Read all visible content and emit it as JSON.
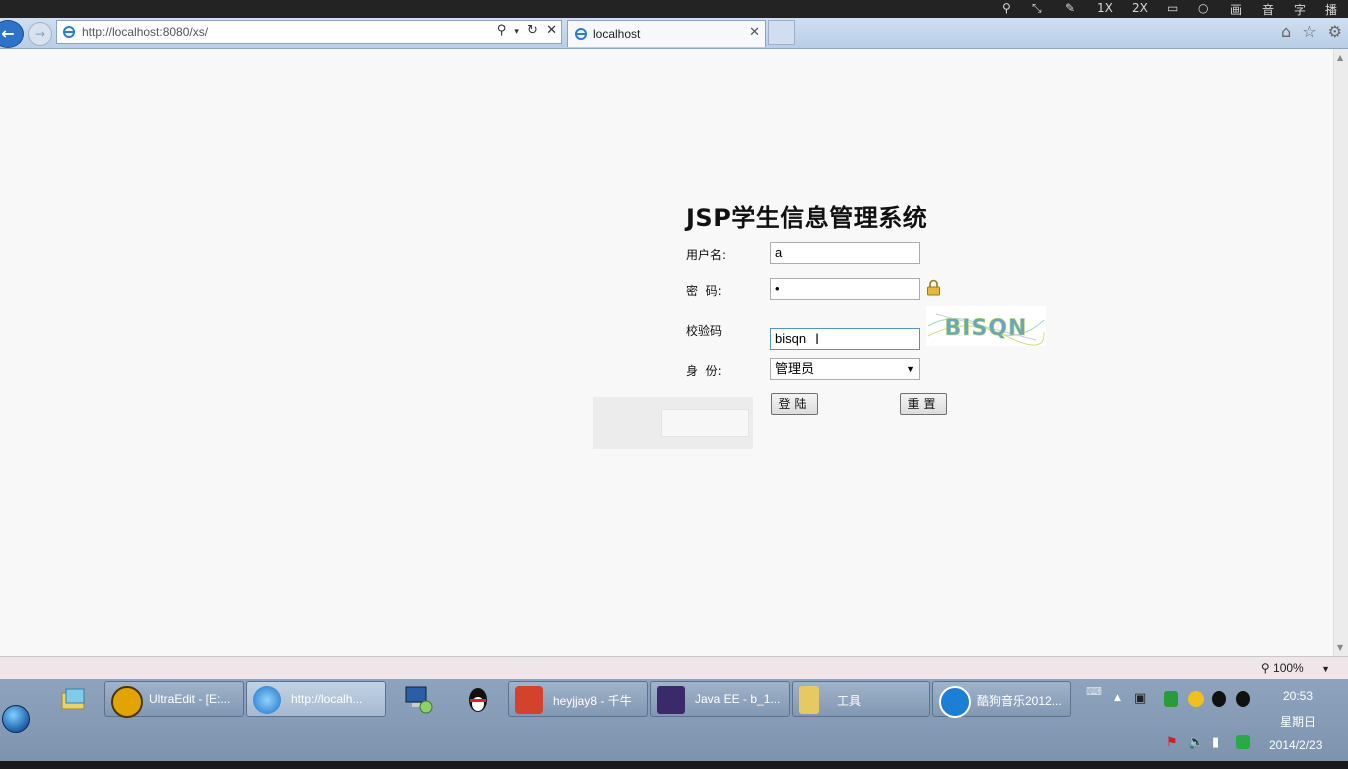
{
  "recorder_bar": {
    "zoom_1x": "1X",
    "zoom_2x": "2X",
    "labels": [
      "画",
      "音",
      "字",
      "播"
    ]
  },
  "browser": {
    "address": "http://localhost:8080/xs/",
    "tab_title": "localhost",
    "colors": {
      "chrome": "#c6d8ee",
      "back_button": "#2f73c8"
    }
  },
  "page": {
    "title": "JSP学生信息管理系统",
    "username_label": "用户名:",
    "username_value": "a",
    "password_label": "密  码:",
    "password_value": "•",
    "captcha_label": "校验码",
    "captcha_value": "bisqn",
    "captcha_image_text": "BISQN",
    "role_label": "身  份:",
    "role_value": "管理员",
    "login_button": "登陆",
    "reset_button": "重置"
  },
  "status_bar": {
    "zoom": "100%"
  },
  "taskbar": {
    "items": [
      {
        "label": "UltraEdit - [E:...",
        "icon": "ultraedit-icon"
      },
      {
        "label": "http://localh...",
        "icon": "ie-icon"
      },
      {
        "label": "heyjjay8 - 千牛",
        "icon": "qianniu-icon"
      },
      {
        "label": "Java EE - b_1...",
        "icon": "java-ee-icon"
      },
      {
        "label": "工具",
        "icon": "folder-icon"
      },
      {
        "label": "酷狗音乐2012...",
        "icon": "kugou-icon"
      }
    ],
    "clock": {
      "time": "20:53",
      "day": "星期日",
      "date": "2014/2/23"
    }
  }
}
